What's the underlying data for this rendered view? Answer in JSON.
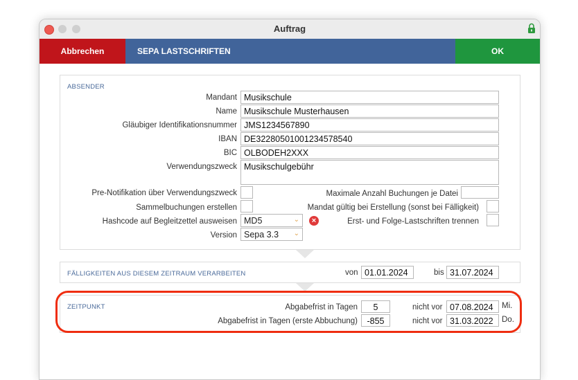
{
  "window": {
    "title": "Auftrag"
  },
  "toolbar": {
    "cancel": "Abbrechen",
    "sepa": "SEPA LASTSCHRIFTEN",
    "ok": "OK"
  },
  "absender": {
    "section": "ABSENDER",
    "mandant_label": "Mandant",
    "mandant": "Musikschule",
    "name_label": "Name",
    "name": "Musikschule Musterhausen",
    "glaeubiger_label": "Gläubiger Identifikationsnummer",
    "glaeubiger": "JMS1234567890",
    "iban_label": "IBAN",
    "iban": "DE32280501001234578540",
    "bic_label": "BIC",
    "bic": "OLBODEH2XXX",
    "zweck_label": "Verwendungszweck",
    "zweck": "Musikschulgebühr",
    "prenotif_label": "Pre-Notifikation über Verwendungszweck",
    "sammel_label": "Sammelbuchungen erstellen",
    "hash_label": "Hashcode auf Begleitzettel ausweisen",
    "hash": "MD5",
    "version_label": "Version",
    "version": "Sepa 3.3",
    "max_label": "Maximale Anzahl Buchungen je Datei",
    "max": "",
    "mandat_label": "Mandat gültig bei Erstellung (sonst bei Fälligkeit)",
    "erst_label": "Erst- und Folge-Lastschriften trennen"
  },
  "faelligkeit": {
    "section": "FÄLLIGKEITEN AUS DIESEM ZEITRAUM VERARBEITEN",
    "von_label": "von",
    "von": "01.01.2024",
    "bis_label": "bis",
    "bis": "31.07.2024"
  },
  "zeitpunkt": {
    "section": "ZEITPUNKT",
    "frist_label": "Abgabefrist in Tagen",
    "frist": "5",
    "frist_erst_label": "Abgabefrist in Tagen (erste Abbuchung)",
    "frist_erst": "-855",
    "nicht_vor_label": "nicht vor",
    "date1": "07.08.2024",
    "day1": "Mi.",
    "date2": "31.03.2022",
    "day2": "Do."
  },
  "colors": {
    "cancel": "#c0151b",
    "sepa": "#41649a",
    "ok": "#1f963e",
    "highlight": "#ef2d10"
  }
}
